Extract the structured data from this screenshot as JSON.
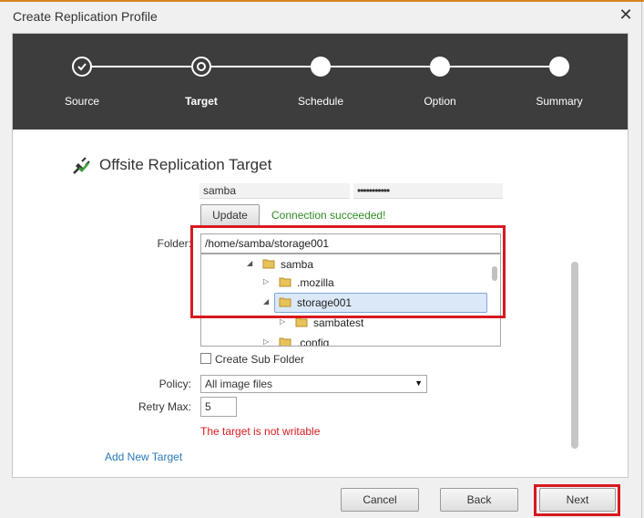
{
  "dialog": {
    "title": "Create Replication Profile",
    "close_glyph": "✕"
  },
  "wizard": {
    "steps": [
      {
        "label": "Source",
        "state": "done"
      },
      {
        "label": "Target",
        "state": "current"
      },
      {
        "label": "Schedule",
        "state": "pending"
      },
      {
        "label": "Option",
        "state": "pending"
      },
      {
        "label": "Summary",
        "state": "pending"
      }
    ]
  },
  "form": {
    "heading": "Offsite Replication Target",
    "username_value": "samba",
    "password_value": "•••••••••••",
    "update_label": "Update",
    "connection_status": "Connection succeeded!",
    "folder_label": "Folder:",
    "folder_value": "/home/samba/storage001",
    "tree": [
      {
        "label": "samba",
        "expanded": true
      },
      {
        "label": ".mozilla",
        "expanded": false
      },
      {
        "label": "storage001",
        "expanded": true,
        "selected": true
      },
      {
        "label": "sambatest",
        "expanded": false
      },
      {
        "label": ".config",
        "expanded": false
      }
    ],
    "create_subfolder_label": "Create Sub Folder",
    "policy_label": "Policy:",
    "policy_value": "All image files",
    "retry_label": "Retry Max:",
    "retry_value": "5",
    "error_message": "The target is not writable",
    "add_new_target_label": "Add New Target"
  },
  "footer": {
    "cancel_label": "Cancel",
    "back_label": "Back",
    "next_label": "Next"
  },
  "colors": {
    "accent": "#d9831f",
    "success": "#2e8b22",
    "error": "#d8191f",
    "link": "#2a7ab8",
    "highlight_box": "#d8191f"
  }
}
